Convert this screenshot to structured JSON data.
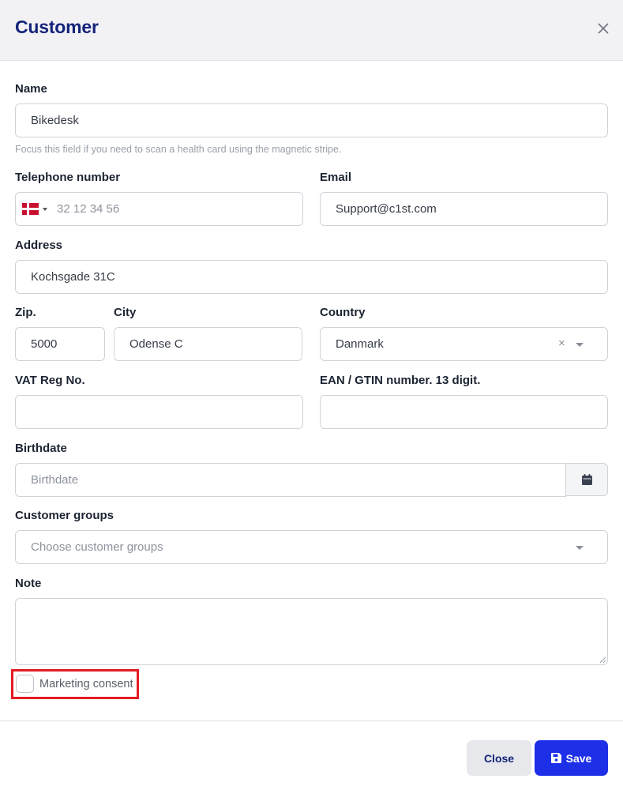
{
  "modal": {
    "title": "Customer"
  },
  "fields": {
    "name": {
      "label": "Name",
      "value": "Bikedesk",
      "hint": "Focus this field if you need to scan a health card using the magnetic stripe."
    },
    "telephone": {
      "label": "Telephone number",
      "placeholder": "32 12 34 56",
      "country_flag": "denmark-flag"
    },
    "email": {
      "label": "Email",
      "value": "Support@c1st.com"
    },
    "address": {
      "label": "Address",
      "value": "Kochsgade 31C"
    },
    "zip": {
      "label": "Zip.",
      "value": "5000"
    },
    "city": {
      "label": "City",
      "value": "Odense C"
    },
    "country": {
      "label": "Country",
      "value": "Danmark"
    },
    "vat": {
      "label": "VAT Reg No.",
      "value": ""
    },
    "ean": {
      "label": "EAN / GTIN number. 13 digit.",
      "value": ""
    },
    "birthdate": {
      "label": "Birthdate",
      "placeholder": "Birthdate"
    },
    "customer_groups": {
      "label": "Customer groups",
      "placeholder": "Choose customer groups"
    },
    "note": {
      "label": "Note",
      "value": ""
    },
    "marketing_consent": {
      "label": "Marketing consent",
      "checked": false
    }
  },
  "footer": {
    "close_label": "Close",
    "save_label": "Save"
  },
  "colors": {
    "title": "#14237a",
    "primary": "#1e2fe8",
    "highlight": "#e31b23"
  }
}
